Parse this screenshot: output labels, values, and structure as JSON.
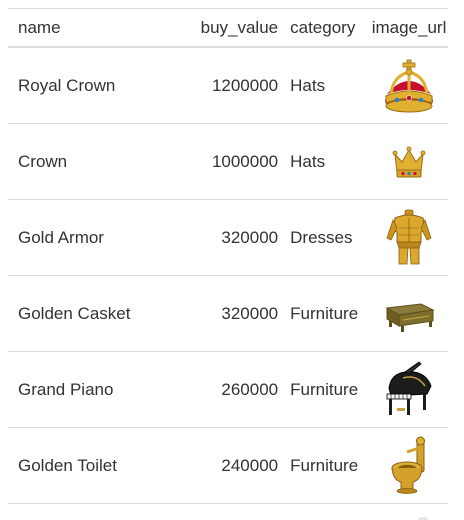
{
  "table": {
    "headers": {
      "name": "name",
      "buy_value": "buy_value",
      "category": "category",
      "image_url": "image_url"
    },
    "rows": [
      {
        "name": "Royal Crown",
        "buy_value": "1200000",
        "category": "Hats",
        "image_icon": "royal-crown-icon"
      },
      {
        "name": "Crown",
        "buy_value": "1000000",
        "category": "Hats",
        "image_icon": "crown-icon"
      },
      {
        "name": "Gold Armor",
        "buy_value": "320000",
        "category": "Dresses",
        "image_icon": "gold-armor-icon"
      },
      {
        "name": "Golden Casket",
        "buy_value": "320000",
        "category": "Furniture",
        "image_icon": "golden-casket-icon"
      },
      {
        "name": "Grand Piano",
        "buy_value": "260000",
        "category": "Furniture",
        "image_icon": "grand-piano-icon"
      },
      {
        "name": "Golden Toilet",
        "buy_value": "240000",
        "category": "Furniture",
        "image_icon": "golden-toilet-icon"
      }
    ]
  },
  "colors": {
    "gold": "#d4a12a",
    "gold_dark": "#9a6e12",
    "red": "#c8102e",
    "border": "#dddddd",
    "text": "#333333"
  }
}
